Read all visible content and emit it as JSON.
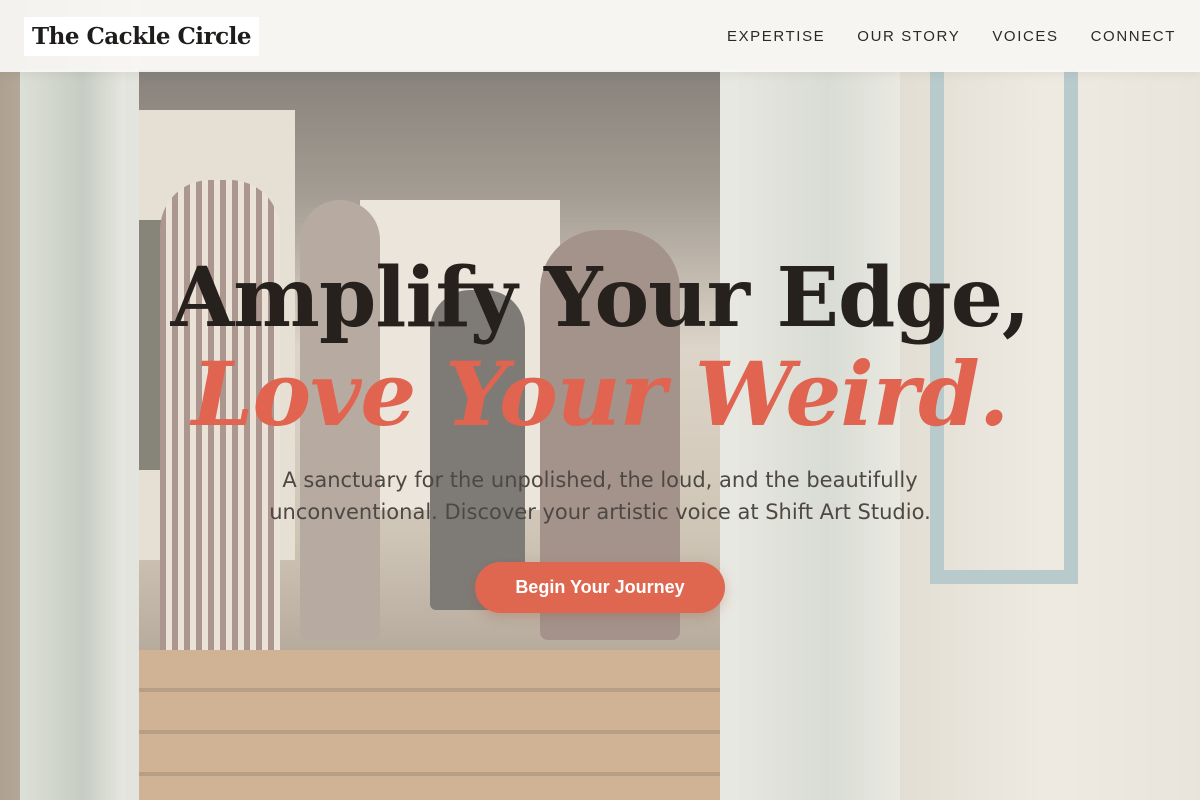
{
  "nav": {
    "brand": "The Cackle Circle",
    "links": [
      "EXPERTISE",
      "OUR STORY",
      "VOICES",
      "CONNECT"
    ]
  },
  "hero": {
    "headline_line1": "Amplify Your Edge,",
    "headline_line2": "Love Your Weird.",
    "subtitle": "A sanctuary for the unpolished, the loud, and the beautifully unconventional. Discover your artistic voice at Shift Art Studio.",
    "cta_label": "Begin Your Journey"
  },
  "colors": {
    "accent": "#df6750",
    "heading": "#26211d",
    "nav_background": "#faf9f6"
  }
}
